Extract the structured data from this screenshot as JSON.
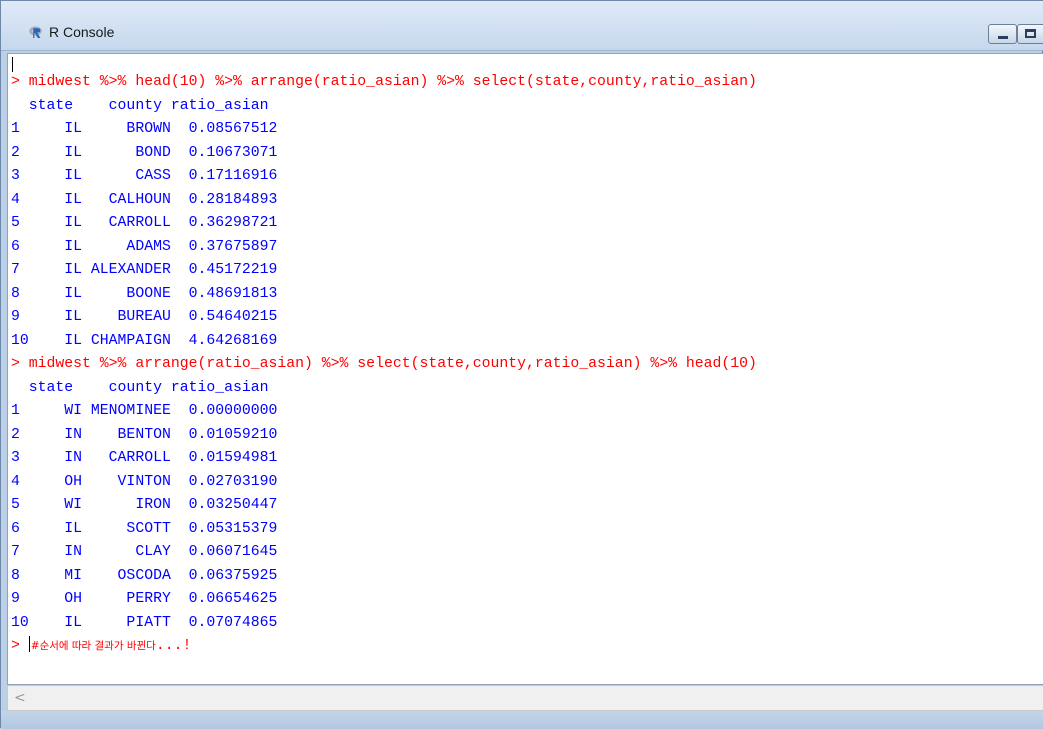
{
  "window": {
    "title": "R Console",
    "icon": "r-logo-icon",
    "minimize_icon": "minimize-icon",
    "maximize_icon": "maximize-icon"
  },
  "console": {
    "lines": [
      {
        "type": "cmd",
        "text": "> midwest %>% head(10) %>% arrange(ratio_asian) %>% select(state,county,ratio_asian)"
      },
      {
        "type": "out",
        "text": "  state    county ratio_asian"
      },
      {
        "type": "out",
        "text": "1     IL     BROWN  0.08567512"
      },
      {
        "type": "out",
        "text": "2     IL      BOND  0.10673071"
      },
      {
        "type": "out",
        "text": "3     IL      CASS  0.17116916"
      },
      {
        "type": "out",
        "text": "4     IL   CALHOUN  0.28184893"
      },
      {
        "type": "out",
        "text": "5     IL   CARROLL  0.36298721"
      },
      {
        "type": "out",
        "text": "6     IL     ADAMS  0.37675897"
      },
      {
        "type": "out",
        "text": "7     IL ALEXANDER  0.45172219"
      },
      {
        "type": "out",
        "text": "8     IL     BOONE  0.48691813"
      },
      {
        "type": "out",
        "text": "9     IL    BUREAU  0.54640215"
      },
      {
        "type": "out",
        "text": "10    IL CHAMPAIGN  4.64268169"
      },
      {
        "type": "cmd",
        "text": "> midwest %>% arrange(ratio_asian) %>% select(state,county,ratio_asian) %>% head(10)"
      },
      {
        "type": "out",
        "text": "  state    county ratio_asian"
      },
      {
        "type": "out",
        "text": "1     WI MENOMINEE  0.00000000"
      },
      {
        "type": "out",
        "text": "2     IN    BENTON  0.01059210"
      },
      {
        "type": "out",
        "text": "3     IN   CARROLL  0.01594981"
      },
      {
        "type": "out",
        "text": "4     OH    VINTON  0.02703190"
      },
      {
        "type": "out",
        "text": "5     WI      IRON  0.03250447"
      },
      {
        "type": "out",
        "text": "6     IL     SCOTT  0.05315379"
      },
      {
        "type": "out",
        "text": "7     IN      CLAY  0.06071645"
      },
      {
        "type": "out",
        "text": "8     MI    OSCODA  0.06375925"
      },
      {
        "type": "out",
        "text": "9     OH     PERRY  0.06654625"
      },
      {
        "type": "out",
        "text": "10    IL     PIATT  0.07074865"
      }
    ],
    "prompt": {
      "prefix": "> ",
      "korean_text": "#순서에 따라 결과가 바뀐다",
      "suffix": "...!"
    }
  },
  "scrollbar": {
    "left_arrow": "<"
  },
  "colors": {
    "command": "#ff0000",
    "output": "#0000ff"
  }
}
